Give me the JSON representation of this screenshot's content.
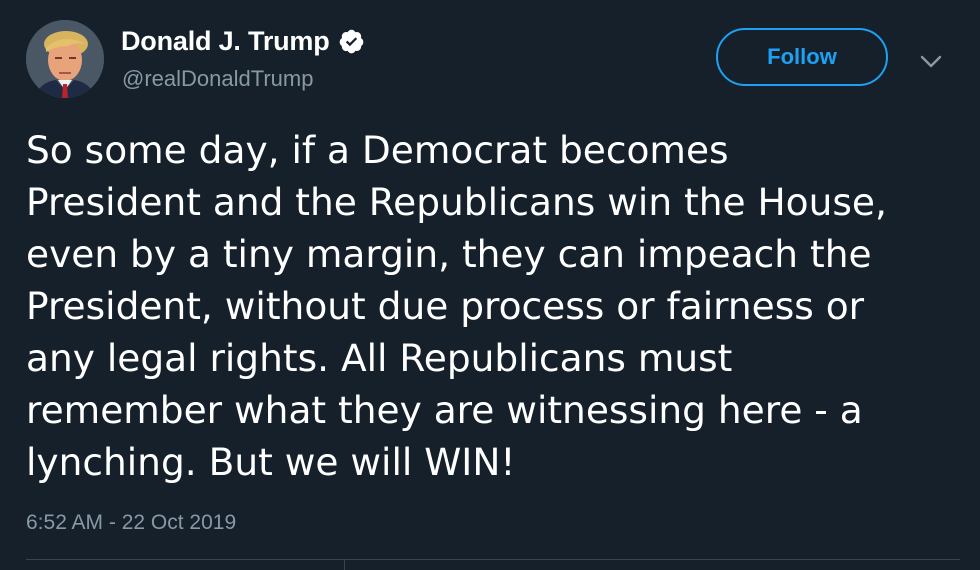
{
  "user": {
    "display_name": "Donald J. Trump",
    "handle": "@realDonaldTrump",
    "verified": true
  },
  "actions": {
    "follow_label": "Follow"
  },
  "tweet": {
    "lines": [
      "So some day, if a Democrat becomes",
      "President and the Republicans win the House,",
      "even by a tiny margin, they can impeach the",
      "President, without due process or fairness or",
      "any legal rights. All Republicans must",
      "remember what they are witnessing here - a",
      "lynching. But we will WIN!"
    ],
    "timestamp": "6:52 AM - 22 Oct 2019"
  },
  "colors": {
    "background": "#15202b",
    "accent": "#1da1f2",
    "secondary_text": "#8899a6",
    "divider": "#38444d"
  },
  "icons": {
    "verified": "verified-badge-icon",
    "menu": "chevron-down-icon"
  }
}
